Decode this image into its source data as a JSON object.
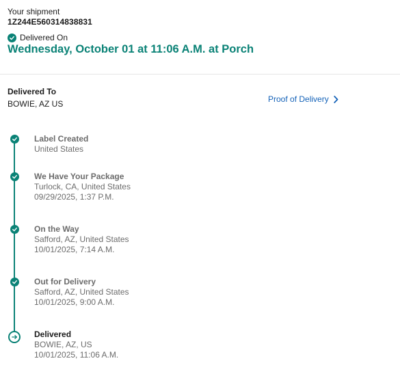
{
  "shipment": {
    "heading": "Your shipment",
    "tracking_number": "1Z244E560314838831",
    "status_label": "Delivered On",
    "delivery_headline": "Wednesday, October 01 at 11:06 A.M. at Porch"
  },
  "destination": {
    "label": "Delivered To",
    "value": "BOWIE, AZ US"
  },
  "proof_of_delivery": {
    "label": "Proof of Delivery"
  },
  "timeline": [
    {
      "title": "Label Created",
      "location": "United States",
      "datetime": "",
      "status": "done"
    },
    {
      "title": "We Have Your Package",
      "location": "Turlock, CA, United States",
      "datetime": "09/29/2025, 1:37 P.M.",
      "status": "done"
    },
    {
      "title": "On the Way",
      "location": "Safford, AZ, United States",
      "datetime": "10/01/2025, 7:14 A.M.",
      "status": "done"
    },
    {
      "title": "Out for Delivery",
      "location": "Safford, AZ, United States",
      "datetime": "10/01/2025, 9:00 A.M.",
      "status": "done"
    },
    {
      "title": "Delivered",
      "location": "BOWIE, AZ, US",
      "datetime": "10/01/2025, 11:06 A.M.",
      "status": "current"
    }
  ],
  "colors": {
    "accent": "#0a8276",
    "link": "#1462b8",
    "muted_text": "#6b6b6b"
  },
  "icons": {
    "status": "check-circle-icon",
    "link": "chevron-right-icon",
    "current_step": "arrow-right-circle-icon"
  }
}
